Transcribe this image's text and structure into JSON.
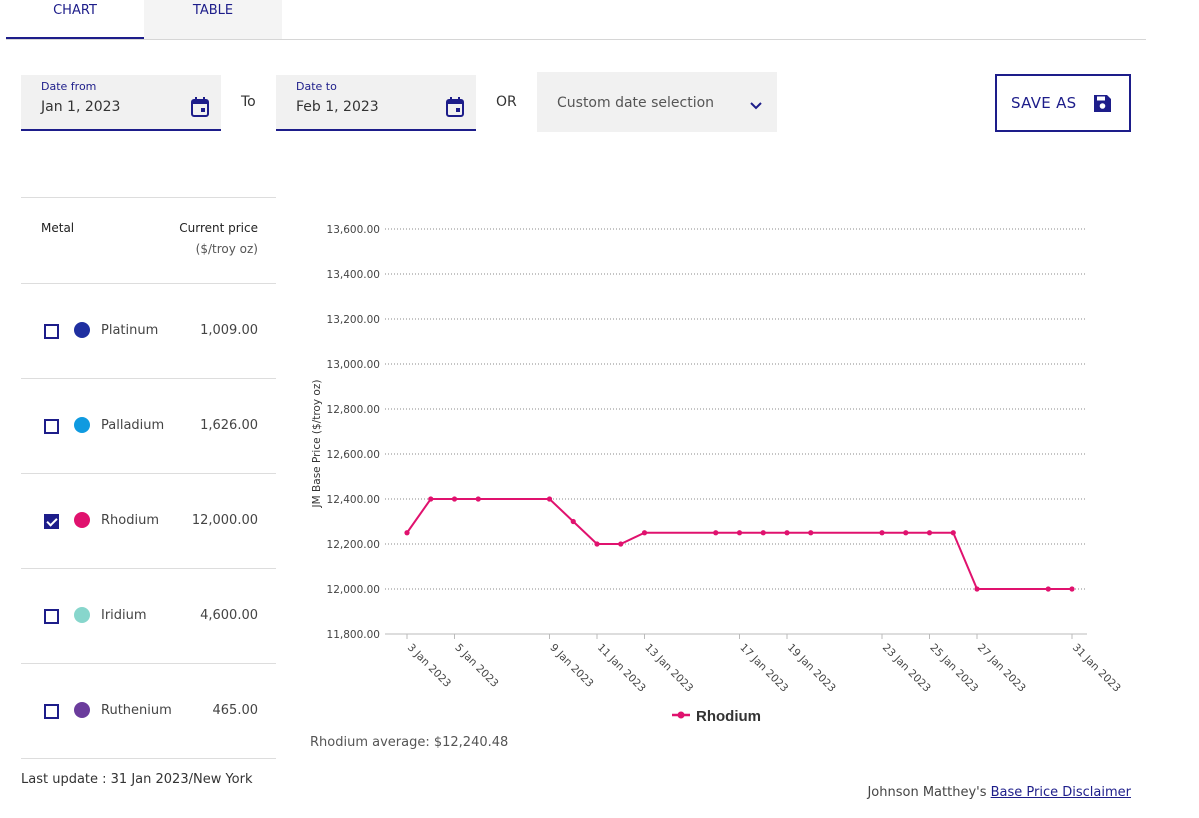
{
  "tabs": [
    {
      "label": "CHART",
      "active": true
    },
    {
      "label": "TABLE",
      "active": false
    }
  ],
  "date_from": {
    "label": "Date from",
    "value": "Jan 1, 2023",
    "icon": "calendar-icon"
  },
  "to_label": "To",
  "date_to": {
    "label": "Date to",
    "value": "Feb 1, 2023",
    "icon": "calendar-icon"
  },
  "or_label": "OR",
  "custom_select": {
    "value": "Custom date selection",
    "icon": "chevron-down-icon"
  },
  "save_as": {
    "label": "SAVE AS",
    "icon": "floppy-disk-icon"
  },
  "metal_table": {
    "header_metal": "Metal",
    "header_price": "Current price",
    "header_unit": "($/troy oz)",
    "rows": [
      {
        "name": "Platinum",
        "price": "1,009.00",
        "color": "#1f2fa0",
        "checked": false
      },
      {
        "name": "Palladium",
        "price": "1,626.00",
        "color": "#0f9ae0",
        "checked": false
      },
      {
        "name": "Rhodium",
        "price": "12,000.00",
        "color": "#e0126e",
        "checked": true
      },
      {
        "name": "Iridium",
        "price": "4,600.00",
        "color": "#87d6cc",
        "checked": false
      },
      {
        "name": "Ruthenium",
        "price": "465.00",
        "color": "#6b3c9c",
        "checked": false
      }
    ]
  },
  "last_update": "Last update : 31 Jan 2023/New York",
  "average": "Rhodium average: $12,240.48",
  "disclaimer": {
    "prefix": "Johnson Matthey's ",
    "link": "Base Price Disclaimer"
  },
  "colors": {
    "accent": "#1d1d8a",
    "rhodium": "#e0126e"
  },
  "chart_data": {
    "type": "line",
    "ylabel": "JM Base Price ($/troy oz)",
    "ylim": [
      11800,
      13600
    ],
    "yticks": [
      "11,800.00",
      "12,000.00",
      "12,200.00",
      "12,400.00",
      "12,600.00",
      "12,800.00",
      "13,000.00",
      "13,200.00",
      "13,400.00",
      "13,600.00"
    ],
    "xticks": [
      "3 Jan 2023",
      "5 Jan 2023",
      "9 Jan 2023",
      "11 Jan 2023",
      "13 Jan 2023",
      "17 Jan 2023",
      "19 Jan 2023",
      "23 Jan 2023",
      "25 Jan 2023",
      "27 Jan 2023",
      "31 Jan 2023"
    ],
    "series": [
      {
        "name": "Rhodium",
        "color": "#e0126e",
        "x": [
          "3 Jan 2023",
          "4 Jan 2023",
          "5 Jan 2023",
          "6 Jan 2023",
          "9 Jan 2023",
          "10 Jan 2023",
          "11 Jan 2023",
          "12 Jan 2023",
          "13 Jan 2023",
          "16 Jan 2023",
          "17 Jan 2023",
          "18 Jan 2023",
          "19 Jan 2023",
          "20 Jan 2023",
          "23 Jan 2023",
          "24 Jan 2023",
          "25 Jan 2023",
          "26 Jan 2023",
          "27 Jan 2023",
          "30 Jan 2023",
          "31 Jan 2023"
        ],
        "values": [
          12250,
          12400,
          12400,
          12400,
          12400,
          12300,
          12200,
          12200,
          12250,
          12250,
          12250,
          12250,
          12250,
          12250,
          12250,
          12250,
          12250,
          12250,
          12000,
          12000,
          12000
        ]
      }
    ],
    "grid": true,
    "legend": "bottom-center"
  }
}
